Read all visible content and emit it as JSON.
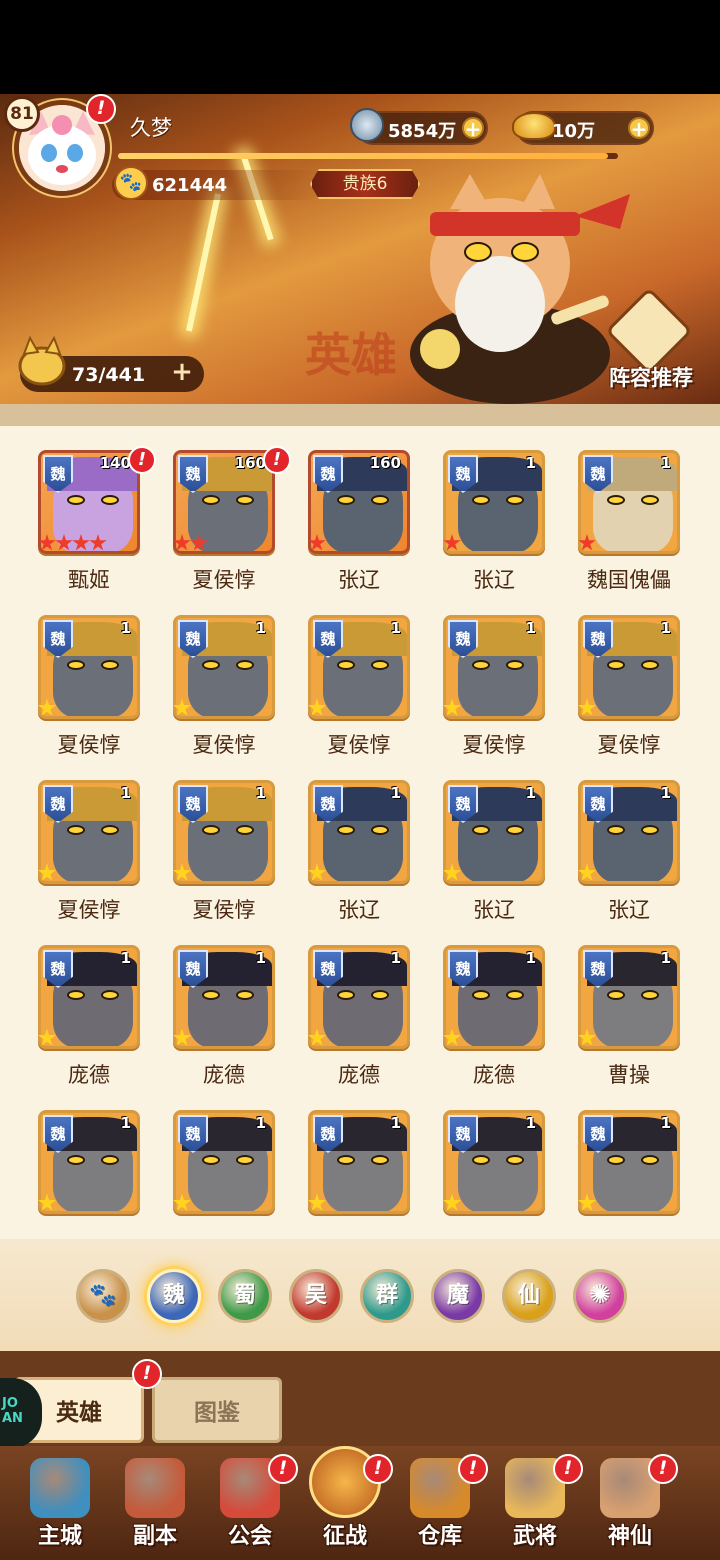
{
  "player": {
    "level": "81",
    "name": "久梦",
    "power": "621444",
    "noble": "贵族6",
    "exp_fraction": 0.98
  },
  "currencies": {
    "silver": "5854万",
    "gold": "10万"
  },
  "header": {
    "roster_count": "73/441",
    "banner_text": "英雄",
    "lineup_label": "阵容推荐"
  },
  "alert_mark": "!",
  "heroes": [
    {
      "name": "甄姬",
      "level": "140",
      "faction": "魏",
      "stars": 4,
      "star_color": "red",
      "alert": true
    },
    {
      "name": "夏侯惇",
      "level": "160",
      "faction": "魏",
      "stars": 2,
      "star_color": "red",
      "alert": true
    },
    {
      "name": "张辽",
      "level": "160",
      "faction": "魏",
      "stars": 1,
      "star_color": "red",
      "alert": false
    },
    {
      "name": "张辽",
      "level": "1",
      "faction": "魏",
      "stars": 1,
      "star_color": "red",
      "alert": false
    },
    {
      "name": "魏国傀儡",
      "level": "1",
      "faction": "魏",
      "stars": 1,
      "star_color": "red",
      "alert": false
    },
    {
      "name": "夏侯惇",
      "level": "1",
      "faction": "魏",
      "stars": 5,
      "star_color": "gold",
      "alert": false
    },
    {
      "name": "夏侯惇",
      "level": "1",
      "faction": "魏",
      "stars": 5,
      "star_color": "gold",
      "alert": false
    },
    {
      "name": "夏侯惇",
      "level": "1",
      "faction": "魏",
      "stars": 5,
      "star_color": "gold",
      "alert": false
    },
    {
      "name": "夏侯惇",
      "level": "1",
      "faction": "魏",
      "stars": 5,
      "star_color": "gold",
      "alert": false
    },
    {
      "name": "夏侯惇",
      "level": "1",
      "faction": "魏",
      "stars": 5,
      "star_color": "gold",
      "alert": false
    },
    {
      "name": "夏侯惇",
      "level": "1",
      "faction": "魏",
      "stars": 5,
      "star_color": "gold",
      "alert": false
    },
    {
      "name": "夏侯惇",
      "level": "1",
      "faction": "魏",
      "stars": 5,
      "star_color": "gold",
      "alert": false
    },
    {
      "name": "张辽",
      "level": "1",
      "faction": "魏",
      "stars": 5,
      "star_color": "gold",
      "alert": false
    },
    {
      "name": "张辽",
      "level": "1",
      "faction": "魏",
      "stars": 5,
      "star_color": "gold",
      "alert": false
    },
    {
      "name": "张辽",
      "level": "1",
      "faction": "魏",
      "stars": 5,
      "star_color": "gold",
      "alert": false
    },
    {
      "name": "庞德",
      "level": "1",
      "faction": "魏",
      "stars": 5,
      "star_color": "gold",
      "alert": false
    },
    {
      "name": "庞德",
      "level": "1",
      "faction": "魏",
      "stars": 5,
      "star_color": "gold",
      "alert": false
    },
    {
      "name": "庞德",
      "level": "1",
      "faction": "魏",
      "stars": 5,
      "star_color": "gold",
      "alert": false
    },
    {
      "name": "庞德",
      "level": "1",
      "faction": "魏",
      "stars": 5,
      "star_color": "gold",
      "alert": false
    },
    {
      "name": "曹操",
      "level": "1",
      "faction": "魏",
      "stars": 5,
      "star_color": "gold",
      "alert": false
    },
    {
      "name": "",
      "level": "1",
      "faction": "魏",
      "stars": 5,
      "star_color": "gold",
      "alert": false
    },
    {
      "name": "",
      "level": "1",
      "faction": "魏",
      "stars": 5,
      "star_color": "gold",
      "alert": false
    },
    {
      "name": "",
      "level": "1",
      "faction": "魏",
      "stars": 5,
      "star_color": "gold",
      "alert": false
    },
    {
      "name": "",
      "level": "1",
      "faction": "魏",
      "stars": 5,
      "star_color": "gold",
      "alert": false
    },
    {
      "name": "",
      "level": "1",
      "faction": "魏",
      "stars": 5,
      "star_color": "gold",
      "alert": false
    }
  ],
  "factions": [
    {
      "label": "",
      "icon": "paw-icon",
      "color": "#c9914a",
      "active": false
    },
    {
      "label": "魏",
      "color": "#3d68b8",
      "active": true
    },
    {
      "label": "蜀",
      "color": "#3e9a48",
      "active": false
    },
    {
      "label": "吴",
      "color": "#c23a2f",
      "active": false
    },
    {
      "label": "群",
      "color": "#2e9a8c",
      "active": false
    },
    {
      "label": "魔",
      "color": "#7a3aa6",
      "active": false
    },
    {
      "label": "仙",
      "color": "#d9a019",
      "active": false
    },
    {
      "label": "",
      "icon": "swirl-icon",
      "color": "#d1409e",
      "active": false
    }
  ],
  "tabs": [
    {
      "label": "英雄",
      "active": true,
      "alert": true
    },
    {
      "label": "图鉴",
      "active": false,
      "alert": false
    }
  ],
  "corner_logo": "JO\nAN",
  "nav": [
    {
      "label": "主城",
      "icon": "castle-icon",
      "alert": false
    },
    {
      "label": "副本",
      "icon": "swords-icon",
      "alert": false
    },
    {
      "label": "公会",
      "icon": "guild-flag-icon",
      "alert": true
    },
    {
      "label": "征战",
      "icon": "battle-icon",
      "alert": true
    },
    {
      "label": "仓库",
      "icon": "bag-icon",
      "alert": true
    },
    {
      "label": "武将",
      "icon": "generals-icon",
      "alert": true
    },
    {
      "label": "神仙",
      "icon": "cat-immortal-icon",
      "alert": true
    }
  ],
  "colors": {
    "star_gold": "#ffd31e",
    "star_red": "#ee3b2a",
    "alert_red": "#e2242b",
    "faction_shield": "#3d68b8"
  }
}
